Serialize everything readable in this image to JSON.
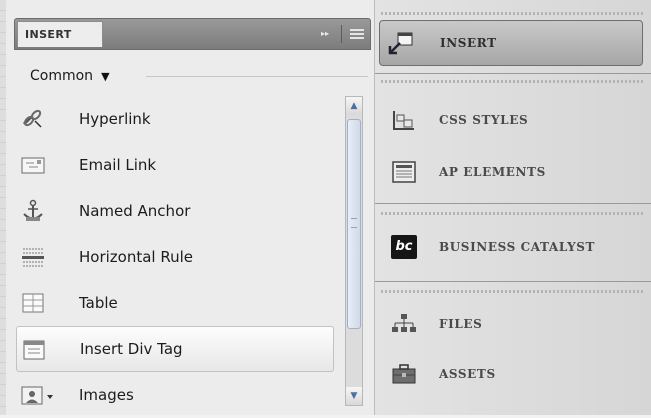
{
  "panel": {
    "tab_label": "INSERT",
    "collapse_glyph": "▸▸",
    "category": "Common",
    "items": [
      {
        "label": "Hyperlink",
        "icon": "hyperlink-icon"
      },
      {
        "label": "Email Link",
        "icon": "email-link-icon"
      },
      {
        "label": "Named Anchor",
        "icon": "named-anchor-icon"
      },
      {
        "label": "Horizontal Rule",
        "icon": "horizontal-rule-icon"
      },
      {
        "label": "Table",
        "icon": "table-icon"
      },
      {
        "label": "Insert Div Tag",
        "icon": "div-tag-icon",
        "selected": true
      },
      {
        "label": "Images",
        "icon": "images-icon"
      }
    ]
  },
  "right_panel": {
    "items": [
      {
        "label": "INSERT",
        "icon": "insert-icon",
        "active": true
      },
      {
        "label": "CSS STYLES",
        "icon": "css-styles-icon"
      },
      {
        "label": "AP ELEMENTS",
        "icon": "ap-elements-icon"
      },
      {
        "label": "BUSINESS CATALYST",
        "icon": "business-catalyst-icon",
        "icon_text": "bc"
      },
      {
        "label": "FILES",
        "icon": "files-icon"
      },
      {
        "label": "ASSETS",
        "icon": "assets-icon"
      }
    ]
  },
  "colors": {
    "accent": "#4a6fa5",
    "tab_bar": "#8a8a8a",
    "selected_item": "#f2f2f2",
    "active_item": "#b5b5b5"
  }
}
